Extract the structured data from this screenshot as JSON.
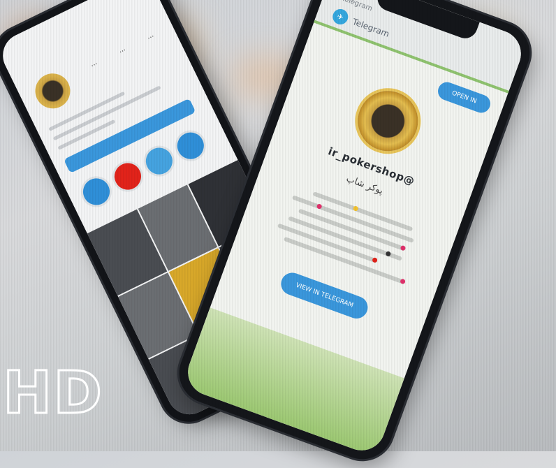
{
  "badge": {
    "text": "HD"
  },
  "telegram_phone": {
    "status_label": "Telegram",
    "app_name": "Telegram",
    "open_top_label": "OPEN IN",
    "username": "ir_pokershop@",
    "channel_title": "پوکر شاپ",
    "open_main_label": "VIEW IN TELEGRAM",
    "accent_color": "#3a97dc",
    "header_stripe_color": "#8fc36f"
  },
  "instagram_phone": {
    "stats": [
      "...",
      "...",
      "..."
    ],
    "highlight_colors": [
      "#2f8fd8",
      "#e2231a",
      "#45a3e0",
      "#2f8fd8"
    ]
  }
}
